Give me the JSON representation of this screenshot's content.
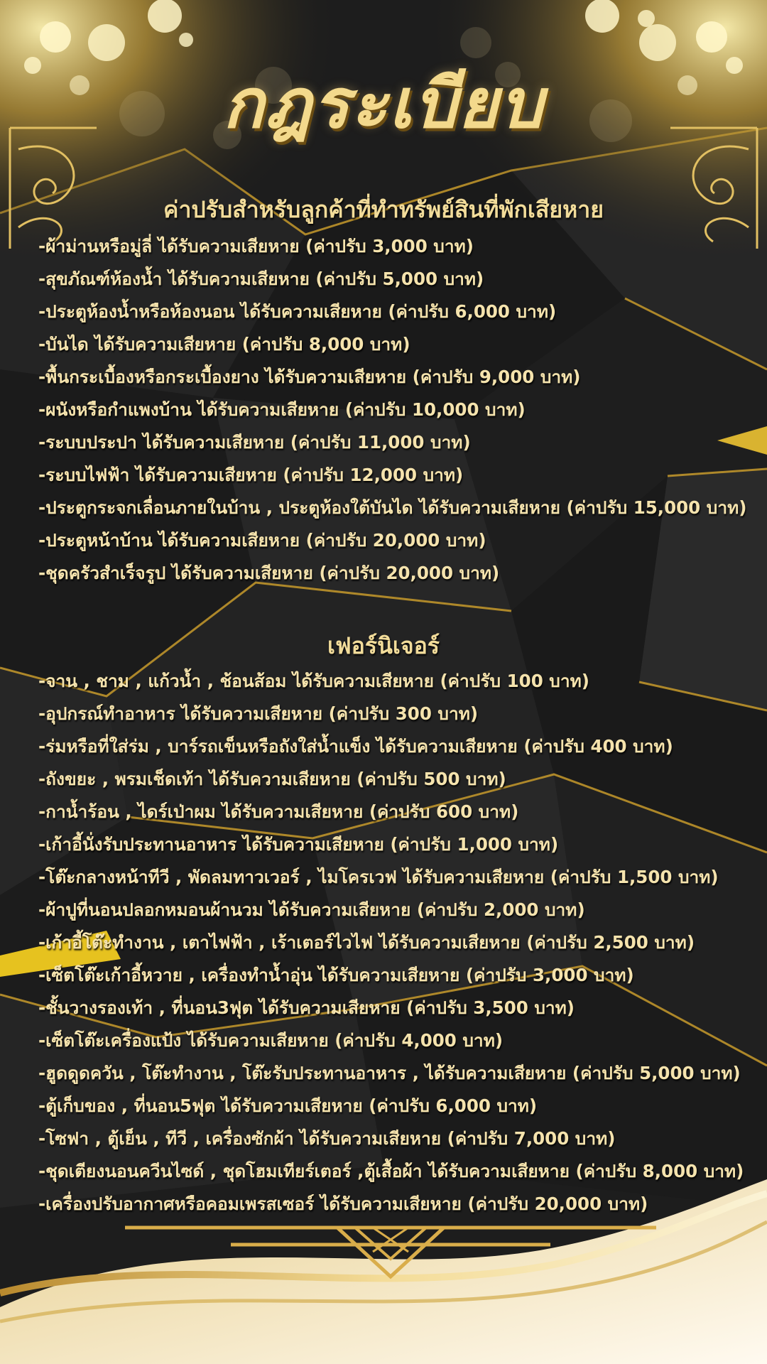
{
  "title": "กฎระเบียบ",
  "colors": {
    "gold": "#d9ad4a",
    "gold_light": "#f5e3ad",
    "background": "#1c1c1c"
  },
  "sections": [
    {
      "heading": "ค่าปรับสำหรับลูกค้าที่ทำทรัพย์สินที่พักเสียหาย",
      "items": [
        "-ผ้าม่านหรือมู่ลี่ ได้รับความเสียหาย (ค่าปรับ 3,000 บาท)",
        "-สุขภัณฑ์ห้องน้ำ ได้รับความเสียหาย (ค่าปรับ 5,000 บาท)",
        "-ประตูห้องน้ำหรือห้องนอน ได้รับความเสียหาย (ค่าปรับ 6,000 บาท)",
        "-บันได ได้รับความเสียหาย (ค่าปรับ 8,000 บาท)",
        "-พื้นกระเบื้องหรือกระเบื้องยาง ได้รับความเสียหาย (ค่าปรับ 9,000 บาท)",
        "-ผนังหรือกำแพงบ้าน ได้รับความเสียหาย (ค่าปรับ 10,000 บาท)",
        "-ระบบประปา ได้รับความเสียหาย (ค่าปรับ 11,000 บาท)",
        "-ระบบไฟฟ้า ได้รับความเสียหาย (ค่าปรับ 12,000 บาท)",
        "-ประตูกระจกเลื่อนภายในบ้าน , ประตูห้องใต้บันได ได้รับความเสียหาย (ค่าปรับ 15,000 บาท)",
        "-ประตูหน้าบ้าน ได้รับความเสียหาย (ค่าปรับ 20,000 บาท)",
        "-ชุดครัวสำเร็จรูป ได้รับความเสียหาย (ค่าปรับ 20,000 บาท)"
      ]
    },
    {
      "heading": "เฟอร์นิเจอร์",
      "items": [
        "-จาน , ชาม , แก้วน้ำ , ช้อนส้อม ได้รับความเสียหาย (ค่าปรับ 100 บาท)",
        "-อุปกรณ์ทำอาหาร ได้รับความเสียหาย (ค่าปรับ 300 บาท)",
        "-ร่มหรือที่ใส่ร่ม , บาร์รถเข็นหรือถังใส่น้ำแข็ง ได้รับความเสียหาย (ค่าปรับ 400 บาท)",
        "-ถังขยะ , พรมเช็ดเท้า ได้รับความเสียหาย (ค่าปรับ 500 บาท)",
        "-กาน้ำร้อน , ไดร์เป่าผม ได้รับความเสียหาย (ค่าปรับ 600 บาท)",
        "-เก้าอี้นั่งรับประทานอาหาร ได้รับความเสียหาย (ค่าปรับ 1,000 บาท)",
        "-โต๊ะกลางหน้าทีวี , พัดลมทาวเวอร์ , ไมโครเวฟ ได้รับความเสียหาย (ค่าปรับ 1,500 บาท)",
        "-ผ้าปูที่นอนปลอกหมอนผ้านวม ได้รับความเสียหาย (ค่าปรับ 2,000 บาท)",
        "-เก้าอี้โต๊ะทำงาน , เตาไฟฟ้า , เร้าเตอร์ไวไฟ ได้รับความเสียหาย (ค่าปรับ 2,500 บาท)",
        "-เซ็ตโต๊ะเก้าอี้หวาย , เครื่องทำน้ำอุ่น ได้รับความเสียหาย (ค่าปรับ 3,000 บาท)",
        "-ชั้นวางรองเท้า , ที่นอน3ฟุต ได้รับความเสียหาย (ค่าปรับ 3,500 บาท)",
        "-เซ็ตโต๊ะเครื่องแป้ง ได้รับความเสียหาย (ค่าปรับ 4,000 บาท)",
        "-ฮูดดูดควัน , โต๊ะทำงาน , โต๊ะรับประทานอาหาร , ได้รับความเสียหาย (ค่าปรับ 5,000 บาท)",
        "-ตู้เก็บของ , ที่นอน5ฟุต ได้รับความเสียหาย (ค่าปรับ 6,000 บาท)",
        "-โซฟา , ตู้เย็น , ทีวี , เครื่องซักผ้า ได้รับความเสียหาย (ค่าปรับ 7,000 บาท)",
        "-ชุดเตียงนอนควีนไซด์ , ชุดโฮมเทียร์เตอร์ ,ตู้เสื้อผ้า ได้รับความเสียหาย (ค่าปรับ 8,000 บาท)",
        "-เครื่องปรับอากาศหรือคอมเพรสเซอร์ ได้รับความเสียหาย (ค่าปรับ 20,000 บาท)"
      ]
    }
  ]
}
